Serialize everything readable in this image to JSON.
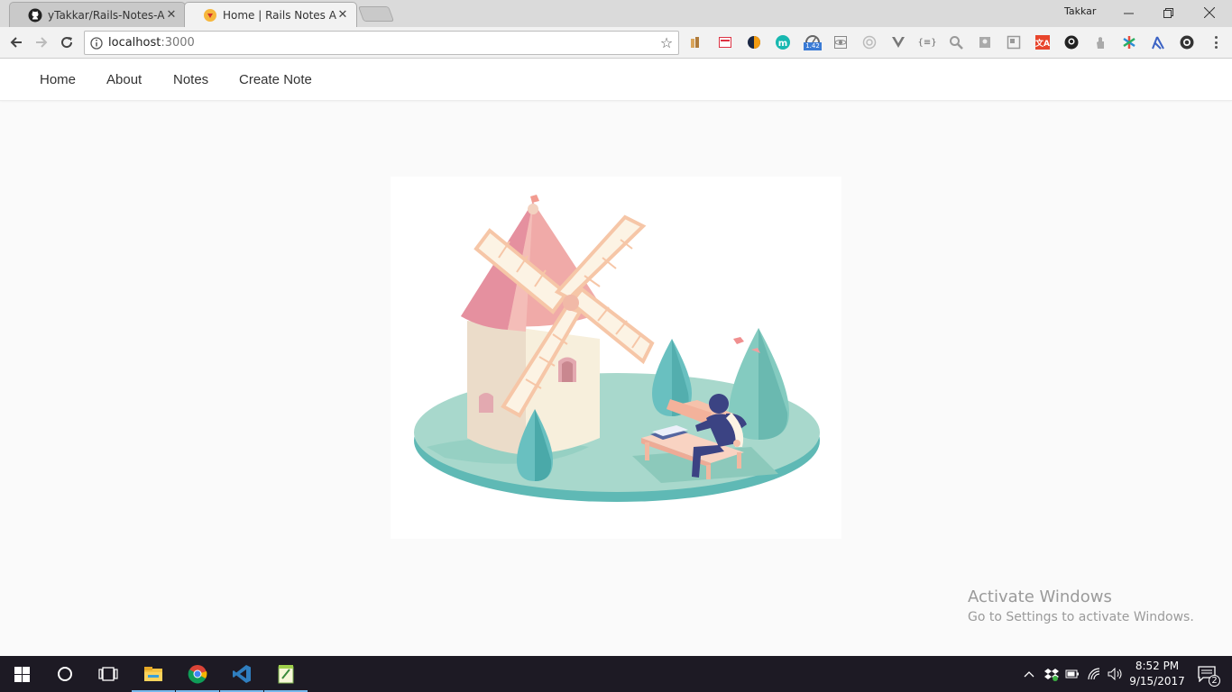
{
  "browser": {
    "tabs": [
      {
        "title": "yTakkar/Rails-Notes-App",
        "favicon": "github-icon",
        "active": false
      },
      {
        "title": "Home | Rails Notes App",
        "favicon": "rails-icon",
        "active": true
      }
    ],
    "profile_name": "Takkar",
    "address": {
      "host": "localhost",
      "port": ":3000"
    },
    "extension_badge": "1.42",
    "window_controls": [
      "minimize-icon",
      "restore-icon",
      "close-icon"
    ]
  },
  "navbar": {
    "links": [
      "Home",
      "About",
      "Notes",
      "Create Note"
    ]
  },
  "hero": {
    "illustration": "windmill-illustration"
  },
  "watermark": {
    "title": "Activate Windows",
    "subtitle": "Go to Settings to activate Windows."
  },
  "taskbar": {
    "apps": [
      "windows-start-icon",
      "cortana-icon",
      "task-view-icon",
      "file-explorer-icon",
      "chrome-icon",
      "vscode-icon",
      "notepad-plus-icon"
    ],
    "time": "8:52 PM",
    "date": "9/15/2017",
    "notification_count": "2"
  },
  "colors": {
    "accent_blue": "#76b9ed",
    "windmill_roof": "#e995a3",
    "island": "#a8d8cc",
    "tree": "#69c0c0"
  }
}
